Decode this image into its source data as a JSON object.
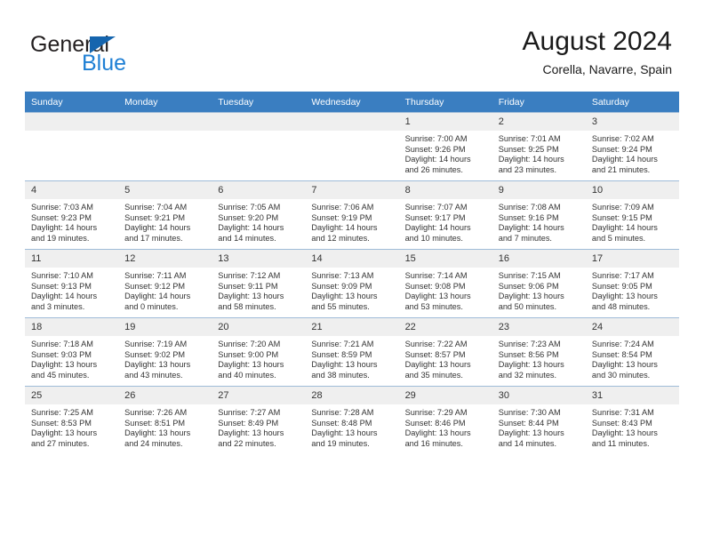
{
  "brand": {
    "name_part1": "General",
    "name_part2": "Blue"
  },
  "header": {
    "title": "August 2024",
    "location": "Corella, Navarre, Spain"
  },
  "colors": {
    "header_band": "#3a7ec1",
    "daynum_band": "#efefef",
    "grid_line": "#9fbcd8",
    "brand_blue": "#1e7fd4",
    "brand_triangle": "#1565ae"
  },
  "weekdays": [
    "Sunday",
    "Monday",
    "Tuesday",
    "Wednesday",
    "Thursday",
    "Friday",
    "Saturday"
  ],
  "weeks": [
    [
      {
        "day": "",
        "empty": true
      },
      {
        "day": "",
        "empty": true
      },
      {
        "day": "",
        "empty": true
      },
      {
        "day": "",
        "empty": true
      },
      {
        "day": "1",
        "sunrise": "Sunrise: 7:00 AM",
        "sunset": "Sunset: 9:26 PM",
        "daylight1": "Daylight: 14 hours",
        "daylight2": "and 26 minutes."
      },
      {
        "day": "2",
        "sunrise": "Sunrise: 7:01 AM",
        "sunset": "Sunset: 9:25 PM",
        "daylight1": "Daylight: 14 hours",
        "daylight2": "and 23 minutes."
      },
      {
        "day": "3",
        "sunrise": "Sunrise: 7:02 AM",
        "sunset": "Sunset: 9:24 PM",
        "daylight1": "Daylight: 14 hours",
        "daylight2": "and 21 minutes."
      }
    ],
    [
      {
        "day": "4",
        "sunrise": "Sunrise: 7:03 AM",
        "sunset": "Sunset: 9:23 PM",
        "daylight1": "Daylight: 14 hours",
        "daylight2": "and 19 minutes."
      },
      {
        "day": "5",
        "sunrise": "Sunrise: 7:04 AM",
        "sunset": "Sunset: 9:21 PM",
        "daylight1": "Daylight: 14 hours",
        "daylight2": "and 17 minutes."
      },
      {
        "day": "6",
        "sunrise": "Sunrise: 7:05 AM",
        "sunset": "Sunset: 9:20 PM",
        "daylight1": "Daylight: 14 hours",
        "daylight2": "and 14 minutes."
      },
      {
        "day": "7",
        "sunrise": "Sunrise: 7:06 AM",
        "sunset": "Sunset: 9:19 PM",
        "daylight1": "Daylight: 14 hours",
        "daylight2": "and 12 minutes."
      },
      {
        "day": "8",
        "sunrise": "Sunrise: 7:07 AM",
        "sunset": "Sunset: 9:17 PM",
        "daylight1": "Daylight: 14 hours",
        "daylight2": "and 10 minutes."
      },
      {
        "day": "9",
        "sunrise": "Sunrise: 7:08 AM",
        "sunset": "Sunset: 9:16 PM",
        "daylight1": "Daylight: 14 hours",
        "daylight2": "and 7 minutes."
      },
      {
        "day": "10",
        "sunrise": "Sunrise: 7:09 AM",
        "sunset": "Sunset: 9:15 PM",
        "daylight1": "Daylight: 14 hours",
        "daylight2": "and 5 minutes."
      }
    ],
    [
      {
        "day": "11",
        "sunrise": "Sunrise: 7:10 AM",
        "sunset": "Sunset: 9:13 PM",
        "daylight1": "Daylight: 14 hours",
        "daylight2": "and 3 minutes."
      },
      {
        "day": "12",
        "sunrise": "Sunrise: 7:11 AM",
        "sunset": "Sunset: 9:12 PM",
        "daylight1": "Daylight: 14 hours",
        "daylight2": "and 0 minutes."
      },
      {
        "day": "13",
        "sunrise": "Sunrise: 7:12 AM",
        "sunset": "Sunset: 9:11 PM",
        "daylight1": "Daylight: 13 hours",
        "daylight2": "and 58 minutes."
      },
      {
        "day": "14",
        "sunrise": "Sunrise: 7:13 AM",
        "sunset": "Sunset: 9:09 PM",
        "daylight1": "Daylight: 13 hours",
        "daylight2": "and 55 minutes."
      },
      {
        "day": "15",
        "sunrise": "Sunrise: 7:14 AM",
        "sunset": "Sunset: 9:08 PM",
        "daylight1": "Daylight: 13 hours",
        "daylight2": "and 53 minutes."
      },
      {
        "day": "16",
        "sunrise": "Sunrise: 7:15 AM",
        "sunset": "Sunset: 9:06 PM",
        "daylight1": "Daylight: 13 hours",
        "daylight2": "and 50 minutes."
      },
      {
        "day": "17",
        "sunrise": "Sunrise: 7:17 AM",
        "sunset": "Sunset: 9:05 PM",
        "daylight1": "Daylight: 13 hours",
        "daylight2": "and 48 minutes."
      }
    ],
    [
      {
        "day": "18",
        "sunrise": "Sunrise: 7:18 AM",
        "sunset": "Sunset: 9:03 PM",
        "daylight1": "Daylight: 13 hours",
        "daylight2": "and 45 minutes."
      },
      {
        "day": "19",
        "sunrise": "Sunrise: 7:19 AM",
        "sunset": "Sunset: 9:02 PM",
        "daylight1": "Daylight: 13 hours",
        "daylight2": "and 43 minutes."
      },
      {
        "day": "20",
        "sunrise": "Sunrise: 7:20 AM",
        "sunset": "Sunset: 9:00 PM",
        "daylight1": "Daylight: 13 hours",
        "daylight2": "and 40 minutes."
      },
      {
        "day": "21",
        "sunrise": "Sunrise: 7:21 AM",
        "sunset": "Sunset: 8:59 PM",
        "daylight1": "Daylight: 13 hours",
        "daylight2": "and 38 minutes."
      },
      {
        "day": "22",
        "sunrise": "Sunrise: 7:22 AM",
        "sunset": "Sunset: 8:57 PM",
        "daylight1": "Daylight: 13 hours",
        "daylight2": "and 35 minutes."
      },
      {
        "day": "23",
        "sunrise": "Sunrise: 7:23 AM",
        "sunset": "Sunset: 8:56 PM",
        "daylight1": "Daylight: 13 hours",
        "daylight2": "and 32 minutes."
      },
      {
        "day": "24",
        "sunrise": "Sunrise: 7:24 AM",
        "sunset": "Sunset: 8:54 PM",
        "daylight1": "Daylight: 13 hours",
        "daylight2": "and 30 minutes."
      }
    ],
    [
      {
        "day": "25",
        "sunrise": "Sunrise: 7:25 AM",
        "sunset": "Sunset: 8:53 PM",
        "daylight1": "Daylight: 13 hours",
        "daylight2": "and 27 minutes."
      },
      {
        "day": "26",
        "sunrise": "Sunrise: 7:26 AM",
        "sunset": "Sunset: 8:51 PM",
        "daylight1": "Daylight: 13 hours",
        "daylight2": "and 24 minutes."
      },
      {
        "day": "27",
        "sunrise": "Sunrise: 7:27 AM",
        "sunset": "Sunset: 8:49 PM",
        "daylight1": "Daylight: 13 hours",
        "daylight2": "and 22 minutes."
      },
      {
        "day": "28",
        "sunrise": "Sunrise: 7:28 AM",
        "sunset": "Sunset: 8:48 PM",
        "daylight1": "Daylight: 13 hours",
        "daylight2": "and 19 minutes."
      },
      {
        "day": "29",
        "sunrise": "Sunrise: 7:29 AM",
        "sunset": "Sunset: 8:46 PM",
        "daylight1": "Daylight: 13 hours",
        "daylight2": "and 16 minutes."
      },
      {
        "day": "30",
        "sunrise": "Sunrise: 7:30 AM",
        "sunset": "Sunset: 8:44 PM",
        "daylight1": "Daylight: 13 hours",
        "daylight2": "and 14 minutes."
      },
      {
        "day": "31",
        "sunrise": "Sunrise: 7:31 AM",
        "sunset": "Sunset: 8:43 PM",
        "daylight1": "Daylight: 13 hours",
        "daylight2": "and 11 minutes."
      }
    ]
  ]
}
